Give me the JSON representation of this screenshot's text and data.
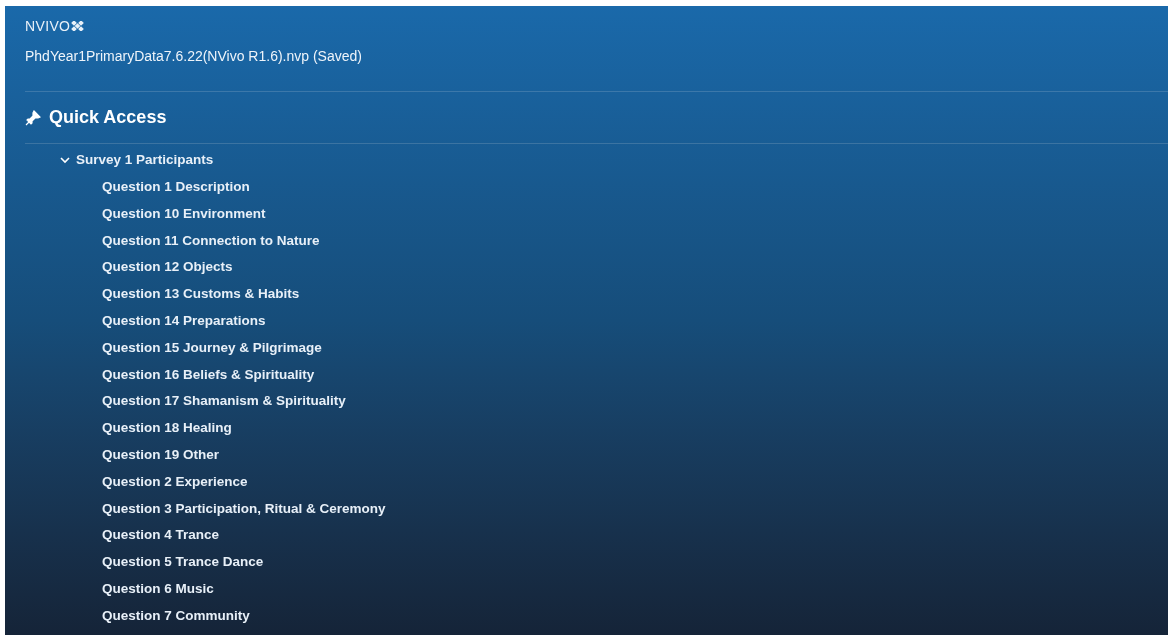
{
  "app": {
    "logo": "NVIVO",
    "project_title": "PhdYear1PrimaryData7.6.22(NVivo R1.6).nvp (Saved)"
  },
  "quick_access": {
    "title": "Quick Access"
  },
  "tree": [
    {
      "label": "Survey 1 Participants",
      "expanded": true,
      "children": [
        {
          "label": "Question 1 Description"
        },
        {
          "label": "Question 10 Environment"
        },
        {
          "label": "Question 11 Connection to Nature"
        },
        {
          "label": "Question 12 Objects"
        },
        {
          "label": "Question 13 Customs & Habits"
        },
        {
          "label": "Question 14 Preparations"
        },
        {
          "label": "Question 15 Journey & Pilgrimage"
        },
        {
          "label": "Question 16 Beliefs & Spirituality"
        },
        {
          "label": "Question 17 Shamanism & Spirituality"
        },
        {
          "label": "Question 18 Healing"
        },
        {
          "label": "Question 19 Other"
        },
        {
          "label": "Question 2 Experience"
        },
        {
          "label": "Question 3 Participation, Ritual & Ceremony"
        },
        {
          "label": "Question 4 Trance"
        },
        {
          "label": "Question 5 Trance Dance"
        },
        {
          "label": "Question 6 Music"
        },
        {
          "label": "Question 7 Community"
        }
      ]
    }
  ]
}
